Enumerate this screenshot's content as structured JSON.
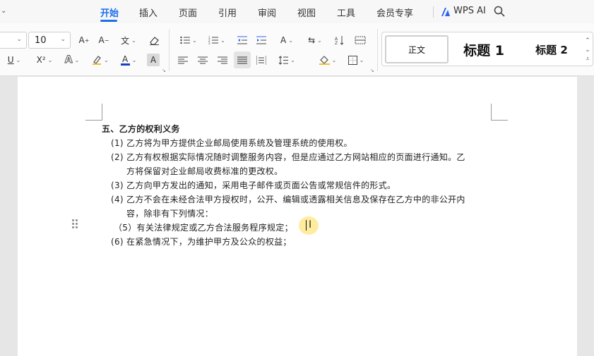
{
  "menu": {
    "tabs": [
      "开始",
      "插入",
      "页面",
      "引用",
      "审阅",
      "视图",
      "工具",
      "会员专享"
    ],
    "wps_ai": "WPS AI"
  },
  "ribbon": {
    "font_size": "10",
    "styles": {
      "normal": "正文",
      "heading1": "标题 1",
      "heading2": "标题 2"
    },
    "font_color": "#1a3fbf"
  },
  "document": {
    "heading": "五、乙方的权利义务",
    "items": [
      "(1) 乙方将为甲方提供企业邮局使用系统及管理系统的使用权。",
      "(2) 乙方有权根据实际情况随时调整服务内容，但是应通过乙方网站相应的页面进行通知。乙",
      "方将保留对企业邮局收费标准的更改权。",
      "(3) 乙方向甲方发出的通知，采用电子邮件或页面公告或常规信件的形式。",
      "(4) 乙方不会在未经合法甲方授权时，公开、编辑或透露相关信息及保存在乙方中的非公开内",
      "容，除非有下列情况：",
      "（5）有关法律规定或乙方合法服务程序规定；",
      "(6) 在紧急情况下，为维护甲方及公众的权益；"
    ]
  }
}
